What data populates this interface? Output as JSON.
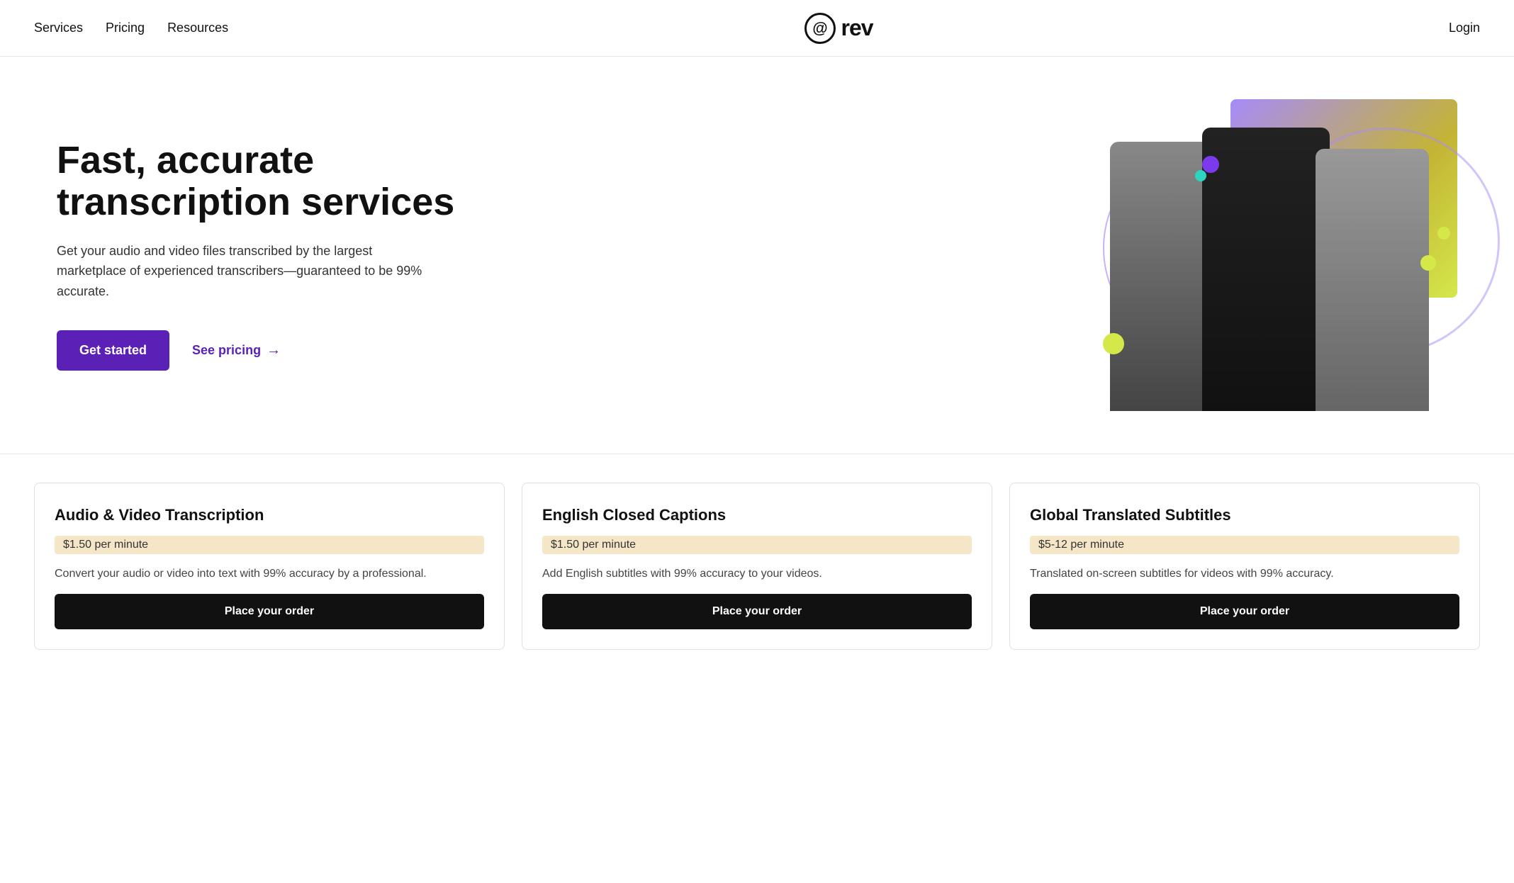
{
  "nav": {
    "logo_symbol": "@",
    "logo_text": "rev",
    "items": [
      {
        "label": "Services",
        "id": "nav-services"
      },
      {
        "label": "Pricing",
        "id": "nav-pricing"
      },
      {
        "label": "Resources",
        "id": "nav-resources"
      }
    ],
    "login_label": "Login"
  },
  "hero": {
    "heading": "Fast, accurate transcription services",
    "description": "Get your audio and video files transcribed by the largest marketplace of experienced transcribers—guaranteed to be 99% accurate.",
    "cta_primary": "Get started",
    "cta_link": "See pricing",
    "cta_arrow": "→"
  },
  "cards": [
    {
      "title": "Audio & Video Transcription",
      "price": "$1.50 per minute",
      "description": "Convert your audio or video into text with 99% accuracy by a professional.",
      "cta": "Place your order"
    },
    {
      "title": "English Closed Captions",
      "price": "$1.50 per minute",
      "description": "Add English subtitles with 99% accuracy to your videos.",
      "cta": "Place your order"
    },
    {
      "title": "Global Translated Subtitles",
      "price": "$5-12 per minute",
      "description": "Translated on-screen subtitles for videos with 99% accuracy.",
      "cta": "Place your order"
    }
  ],
  "colors": {
    "primary": "#5b21b6",
    "black": "#111111",
    "price_bg": "#f5e6c8"
  }
}
